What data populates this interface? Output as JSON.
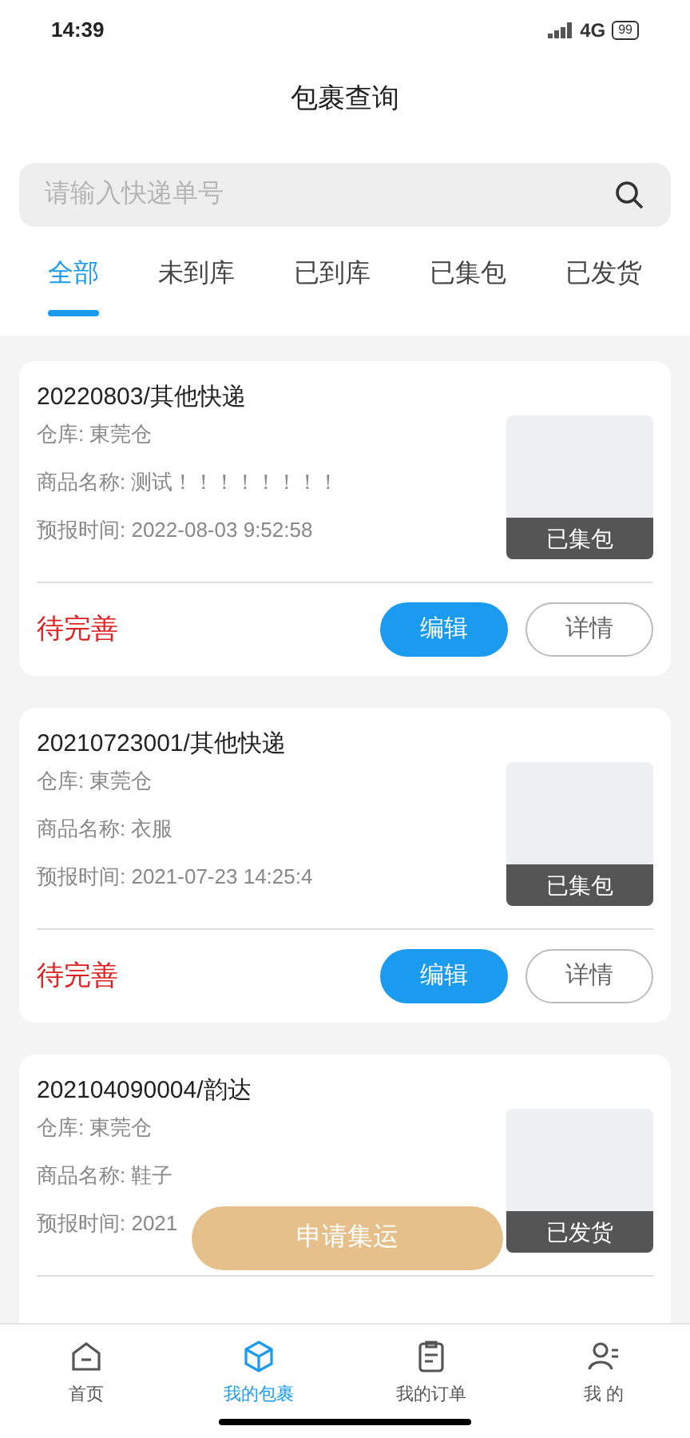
{
  "status_bar": {
    "time": "14:39",
    "network": "4G",
    "battery": "99"
  },
  "header": {
    "title": "包裹查询"
  },
  "search": {
    "placeholder": "请输入快递单号"
  },
  "tabs": [
    {
      "label": "全部",
      "selected": true
    },
    {
      "label": "未到库",
      "selected": false
    },
    {
      "label": "已到库",
      "selected": false
    },
    {
      "label": "已集包",
      "selected": false
    },
    {
      "label": "已发货",
      "selected": false
    }
  ],
  "parcels": [
    {
      "title": "20220803/其他快递",
      "warehouse": "仓库: 東莞仓",
      "goods": "商品名称: 测试！！！！！！！！",
      "time": "预报时间: 2022-08-03 9:52:58",
      "badge": "已集包",
      "status": "待完善",
      "actions": [
        "编辑",
        "详情"
      ]
    },
    {
      "title": "20210723001/其他快递",
      "warehouse": "仓库: 東莞仓",
      "goods": "商品名称: 衣服",
      "time": "预报时间: 2021-07-23 14:25:4",
      "badge": "已集包",
      "status": "待完善",
      "actions": [
        "编辑",
        "详情"
      ]
    },
    {
      "title": "202104090004/韵达",
      "warehouse": "仓库: 東莞仓",
      "goods": "商品名称: 鞋子",
      "time": "预报时间: 2021",
      "badge": "已发货"
    }
  ],
  "floating_button": "申请集运",
  "bottom_nav": [
    {
      "label": "首页",
      "kind": "home",
      "selected": false
    },
    {
      "label": "我的包裹",
      "kind": "box",
      "selected": true
    },
    {
      "label": "我的订单",
      "kind": "orders",
      "selected": false
    },
    {
      "label": "我 的",
      "kind": "user",
      "selected": false
    }
  ]
}
